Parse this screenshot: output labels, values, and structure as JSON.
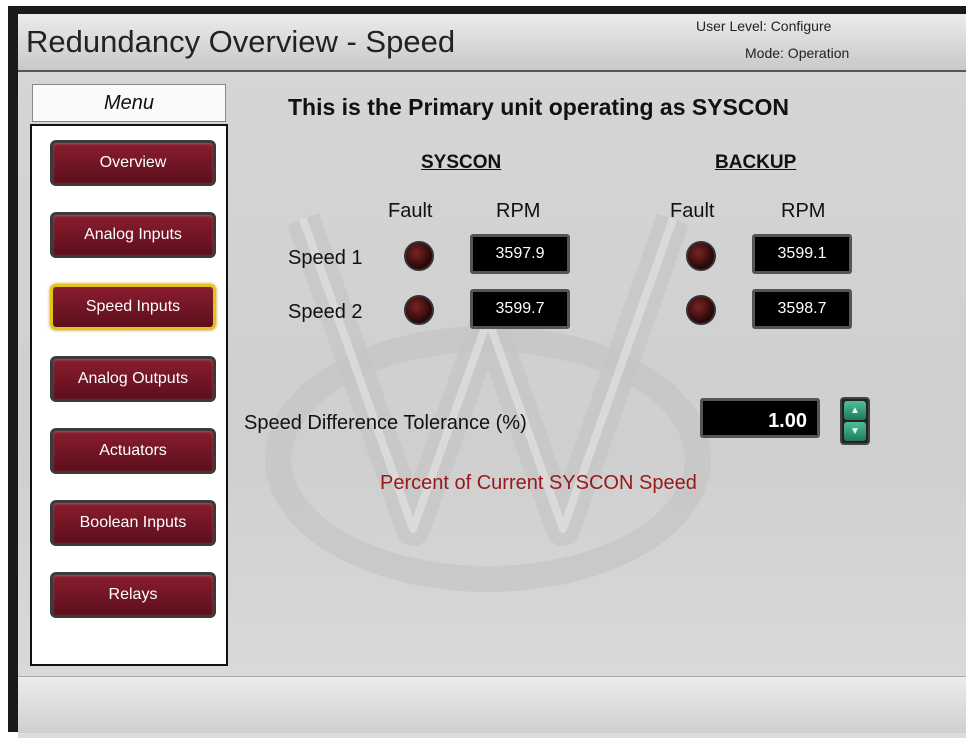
{
  "header": {
    "title": "Redundancy Overview - Speed",
    "user_level": "User Level: Configure",
    "mode": "Mode: Operation"
  },
  "menu": {
    "title": "Menu",
    "items": [
      {
        "label": "Overview",
        "active": false
      },
      {
        "label": "Analog Inputs",
        "active": false
      },
      {
        "label": "Speed Inputs",
        "active": true
      },
      {
        "label": "Analog Outputs",
        "active": false
      },
      {
        "label": "Actuators",
        "active": false
      },
      {
        "label": "Boolean Inputs",
        "active": false
      },
      {
        "label": "Relays",
        "active": false
      }
    ]
  },
  "main": {
    "status_message": "This is the Primary unit operating as SYSCON",
    "syscon": {
      "header": "SYSCON",
      "fault_label": "Fault",
      "rpm_label": "RPM",
      "speed1_rpm": "3597.9",
      "speed2_rpm": "3599.7"
    },
    "backup": {
      "header": "BACKUP",
      "fault_label": "Fault",
      "rpm_label": "RPM",
      "speed1_rpm": "3599.1",
      "speed2_rpm": "3598.7"
    },
    "rows": {
      "speed1_label": "Speed 1",
      "speed2_label": "Speed 2"
    },
    "tolerance": {
      "label": "Speed Difference Tolerance (%)",
      "value": "1.00",
      "note": "Percent of Current SYSCON Speed"
    }
  },
  "colors": {
    "button": "#7a1526",
    "active_border": "#e2c21b",
    "note_text": "#9a1818",
    "led_off": "#4a1010",
    "spinner": "#2f9b73"
  },
  "icons": {
    "fault_indicator": "led-off",
    "spinner_up": "triangle-up",
    "spinner_down": "triangle-down"
  }
}
